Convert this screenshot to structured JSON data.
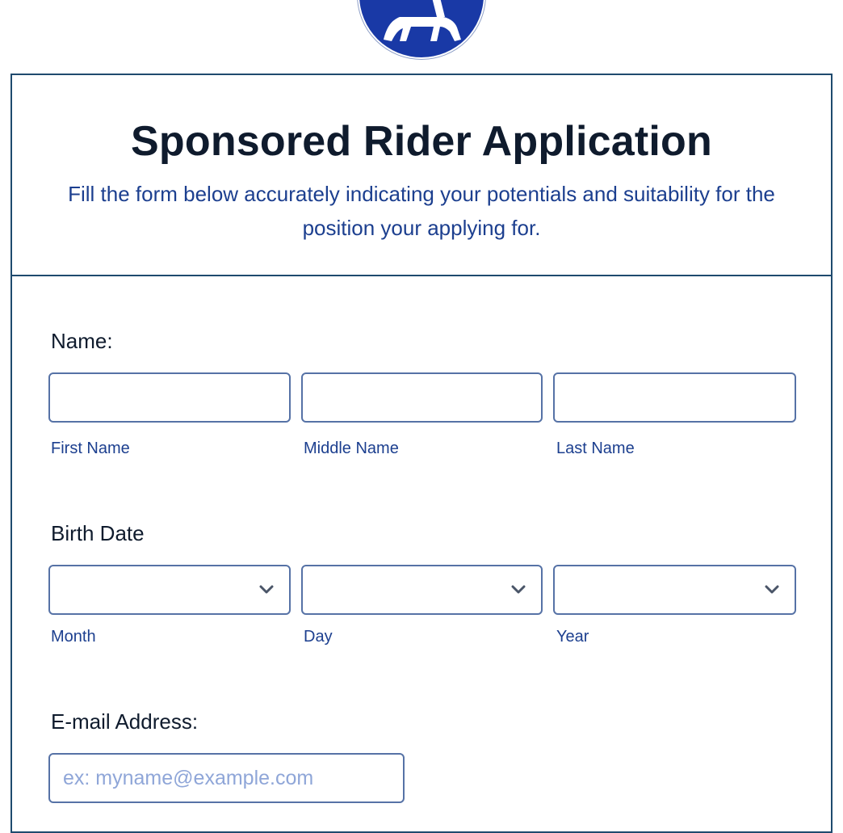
{
  "logo": {
    "icon": "horse-icon",
    "bg_color": "#1939a6"
  },
  "form": {
    "title": "Sponsored Rider Application",
    "subtitle": "Fill the form below accurately indicating your potentials and suitability for the position your applying for."
  },
  "name_field": {
    "label": "Name:",
    "first_label": "First Name",
    "middle_label": "Middle Name",
    "last_label": "Last Name",
    "first_value": "",
    "middle_value": "",
    "last_value": ""
  },
  "birth_date": {
    "label": "Birth Date",
    "month_label": "Month",
    "day_label": "Day",
    "year_label": "Year",
    "month_value": "",
    "day_value": "",
    "year_value": ""
  },
  "email": {
    "label": "E-mail Address:",
    "placeholder": "ex: myname@example.com",
    "value": ""
  },
  "colors": {
    "accent": "#1c3f8f",
    "border": "#1f4a6e",
    "input_border": "#5672a6"
  }
}
